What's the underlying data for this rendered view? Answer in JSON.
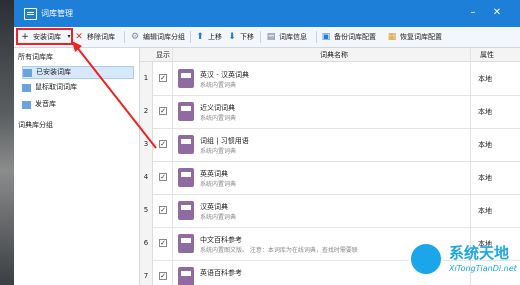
{
  "window": {
    "title": "词库管理"
  },
  "toolbar": {
    "install": "安装词库",
    "remove": "移除词库",
    "edit_group": "编辑词库分组",
    "move_up": "上移",
    "move_down": "下移",
    "info": "词库信息",
    "backup": "备份词库配置",
    "restore": "恢复词库配置"
  },
  "sidebar": {
    "all_heading": "所有词库库",
    "items": [
      {
        "label": "已安装词库"
      },
      {
        "label": "鼠标取词词库"
      },
      {
        "label": "发音库"
      }
    ],
    "groups_heading": "词典库分组"
  },
  "table": {
    "headers": {
      "display": "显示",
      "name": "词典名称",
      "attr": "属性"
    },
    "rows": [
      {
        "num": "1",
        "name": "英汉 - 汉英词典",
        "desc": "系统内置词典",
        "attr": "本地"
      },
      {
        "num": "2",
        "name": "近义词词典",
        "desc": "系统内置词典",
        "attr": "本地"
      },
      {
        "num": "3",
        "name": "词组 | 习惯用语",
        "desc": "系统内置词典",
        "attr": "本地"
      },
      {
        "num": "4",
        "name": "英英词典",
        "desc": "系统内置词典",
        "attr": "本地"
      },
      {
        "num": "5",
        "name": "汉英词典",
        "desc": "系统内置词典",
        "attr": "本地"
      },
      {
        "num": "6",
        "name": "中文百科参考",
        "desc": "系统内置图文版。  注意：本词库为在线词典，查找时需要联",
        "attr": "本地"
      },
      {
        "num": "7",
        "name": "英语百科参考",
        "desc": "",
        "attr": ""
      }
    ]
  },
  "watermark": {
    "title": "系统天地",
    "url": "XiTongTianDi.net"
  },
  "colors": {
    "titlebar": "#1e7fd8",
    "highlight": "#e22222",
    "book": "#8f6ba2"
  }
}
